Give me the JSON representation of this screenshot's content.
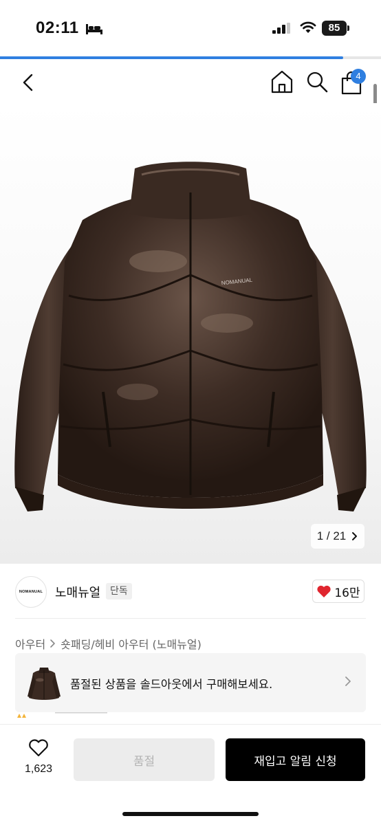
{
  "status_bar": {
    "time": "02:11",
    "battery": "85"
  },
  "page_progress": 0.9,
  "nav": {
    "cart_count": "4"
  },
  "gallery": {
    "jacket_logo": "NOMANUAL",
    "counter": "1 / 21",
    "next_icon": "chevron-right-icon"
  },
  "brand": {
    "logo_text": "NOMANUAL",
    "name": "노매뉴얼",
    "badge": "단독",
    "likes": "16만"
  },
  "category": {
    "level1": "아우터",
    "level2": "숏패딩/헤비 아우터 (노매뉴얼)"
  },
  "soldout_banner": {
    "text": "품절된 상품을 솔드아웃에서 구매해보세요."
  },
  "bottom_bar": {
    "wish_count": "1,623",
    "soldout_label": "품절",
    "restock_label": "재입고 알림 신청"
  },
  "colors": {
    "accent": "#2f7fe0",
    "heart": "#e0252e",
    "jacket": "#3b2a22"
  }
}
